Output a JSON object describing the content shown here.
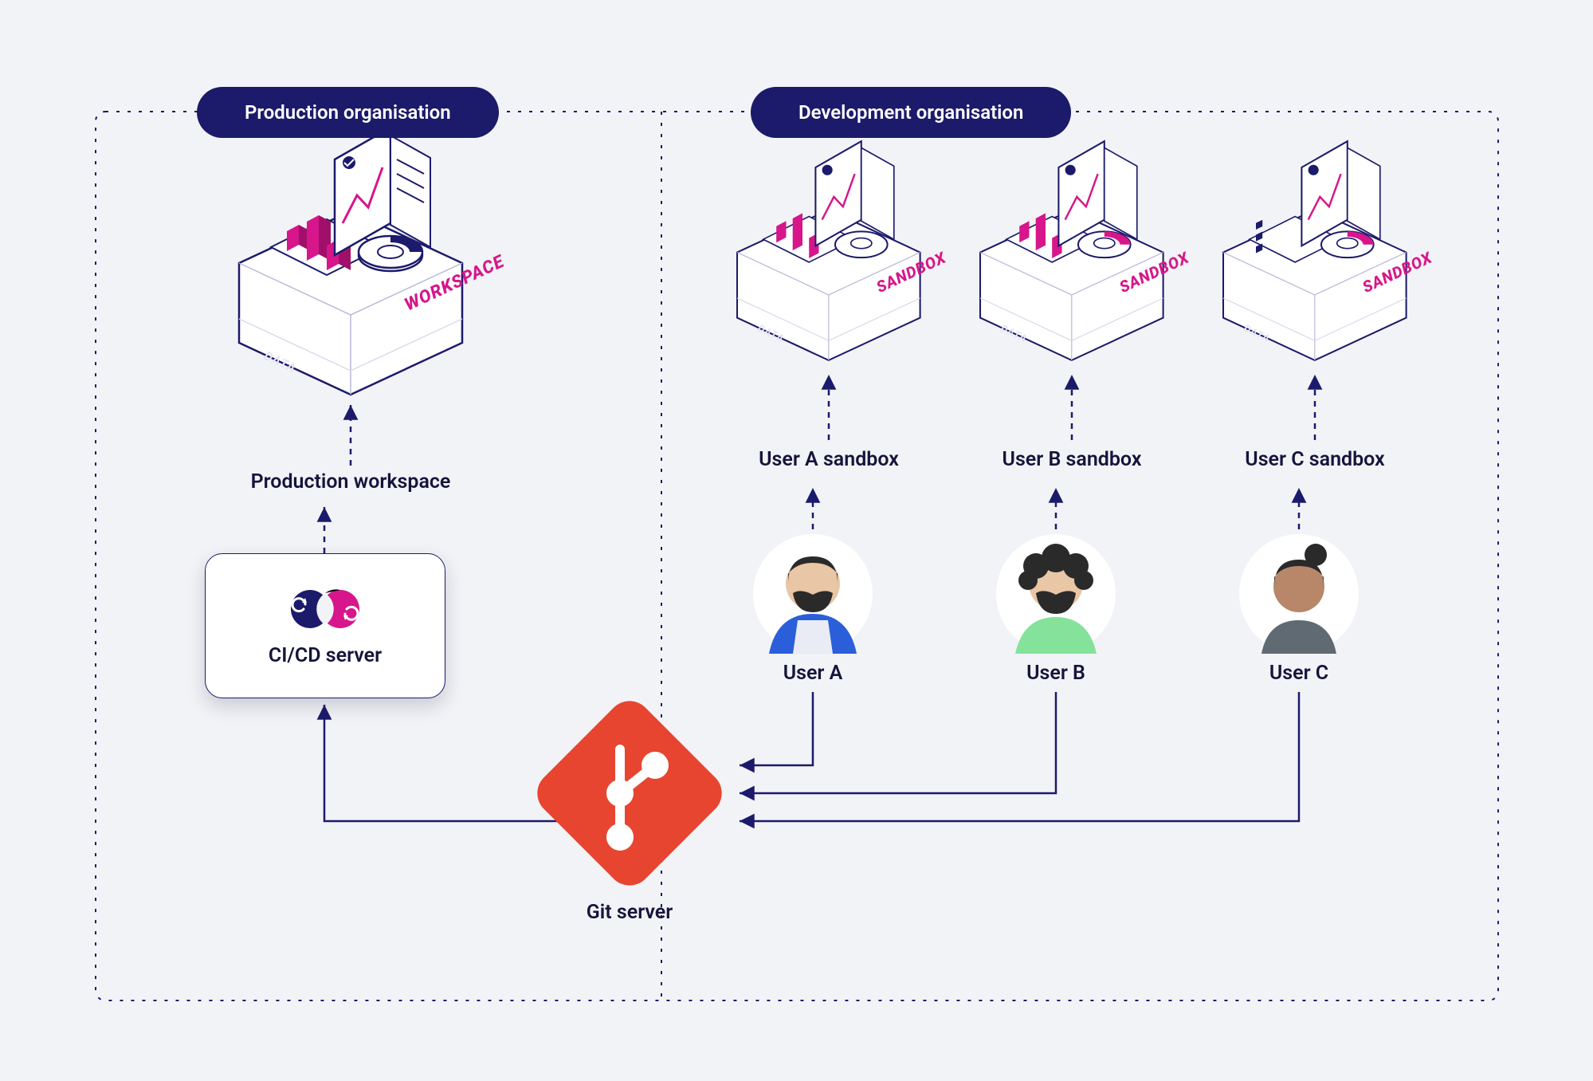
{
  "colors": {
    "navy": "#1c1a6b",
    "magenta": "#d6168a",
    "orange": "#e74530",
    "bg": "#f2f3f6"
  },
  "production": {
    "pill_label": "Production organisation",
    "workspace_label": "Production workspace",
    "box_label": "WORKSPACE",
    "box_sub": "DATA",
    "cicd_label": "CI/CD server"
  },
  "development": {
    "pill_label": "Development organisation",
    "sandboxes": [
      {
        "box_label": "SANDBOX",
        "box_sub": "DATA",
        "sandbox_label": "User A sandbox",
        "user_label": "User A"
      },
      {
        "box_label": "SANDBOX",
        "box_sub": "DATA",
        "sandbox_label": "User B sandbox",
        "user_label": "User B"
      },
      {
        "box_label": "SANDBOX",
        "box_sub": "DATA",
        "sandbox_label": "User C sandbox",
        "user_label": "User C"
      }
    ]
  },
  "git": {
    "label": "Git server"
  }
}
